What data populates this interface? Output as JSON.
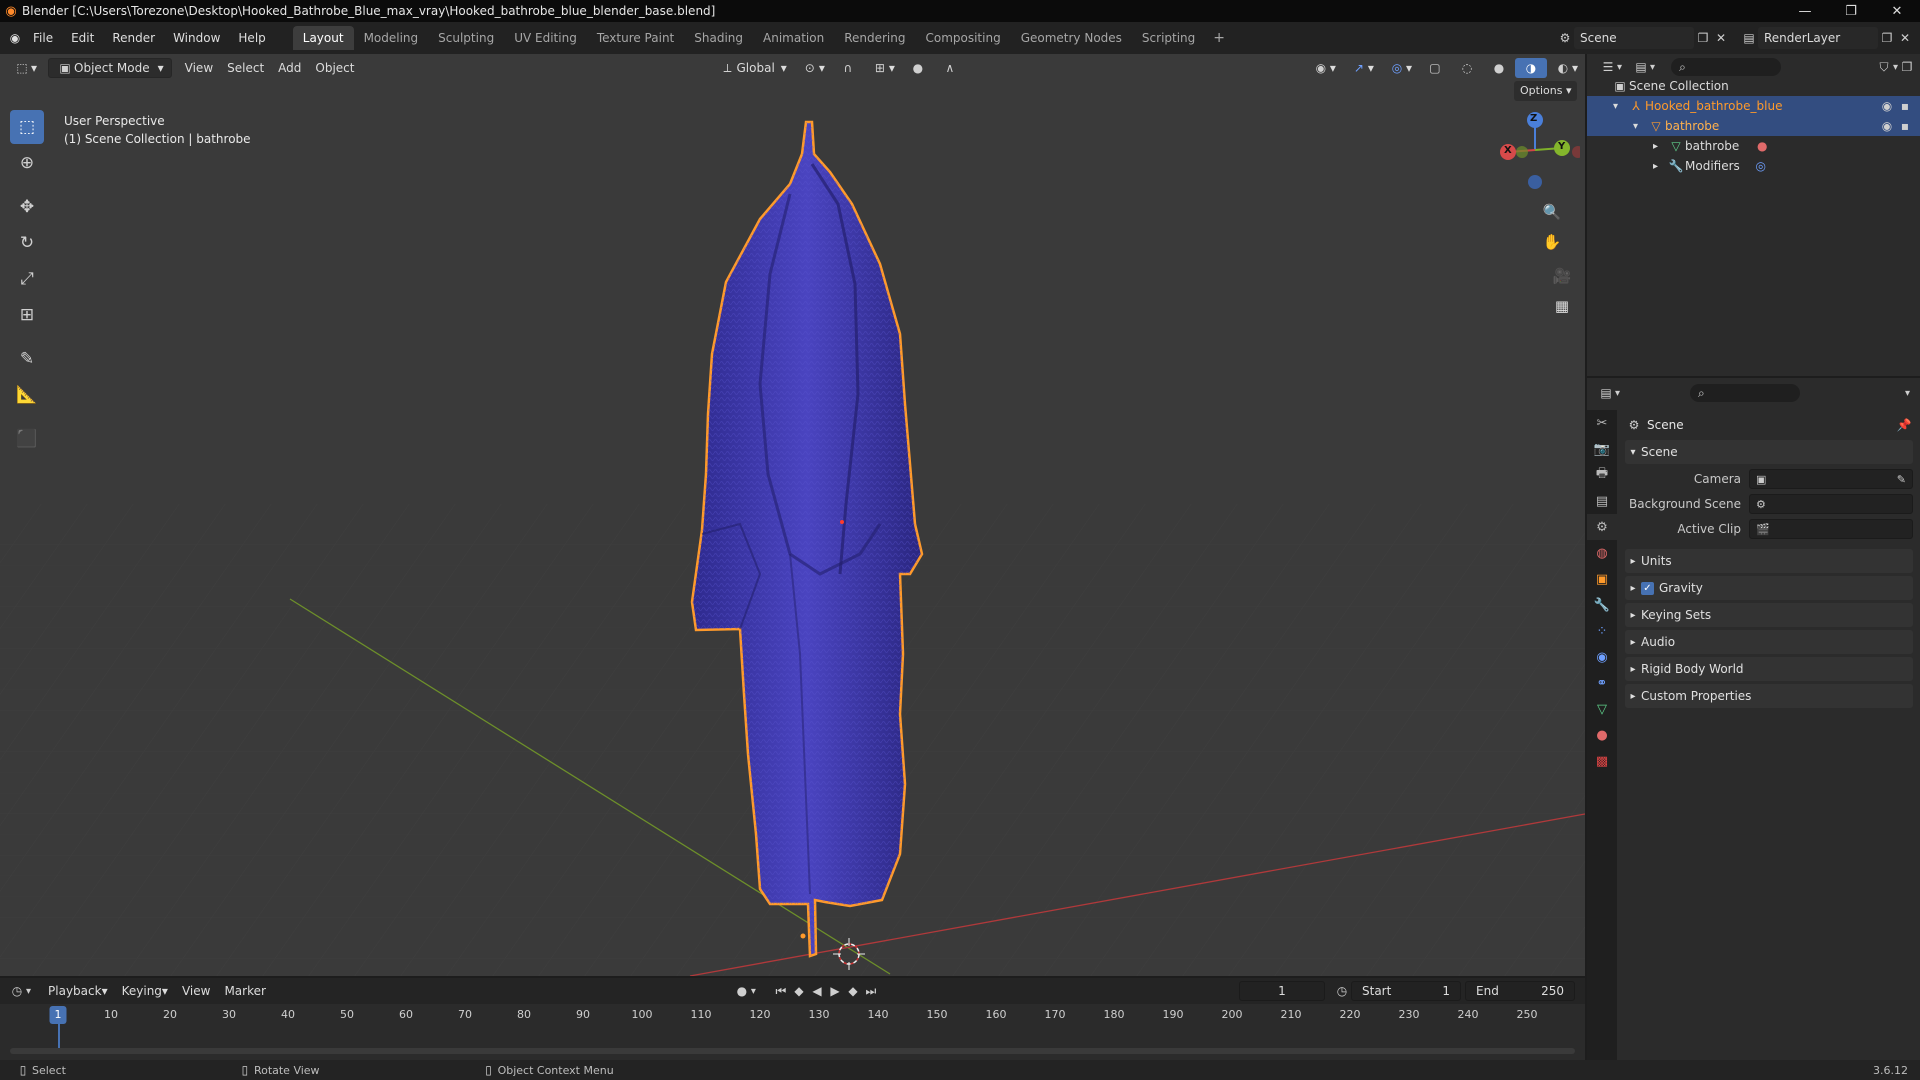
{
  "window": {
    "title": "Blender [C:\\Users\\Torezone\\Desktop\\Hooked_Bathrobe_Blue_max_vray\\Hooked_bathrobe_blue_blender_base.blend]"
  },
  "menu": [
    "File",
    "Edit",
    "Render",
    "Window",
    "Help"
  ],
  "workspaces": [
    {
      "label": "Layout",
      "active": true
    },
    {
      "label": "Modeling"
    },
    {
      "label": "Sculpting"
    },
    {
      "label": "UV Editing"
    },
    {
      "label": "Texture Paint"
    },
    {
      "label": "Shading"
    },
    {
      "label": "Animation"
    },
    {
      "label": "Rendering"
    },
    {
      "label": "Compositing"
    },
    {
      "label": "Geometry Nodes"
    },
    {
      "label": "Scripting"
    }
  ],
  "scene_selector": {
    "scene": "Scene",
    "view_layer": "RenderLayer"
  },
  "viewport": {
    "mode": "Object Mode",
    "header_menus": [
      "View",
      "Select",
      "Add",
      "Object"
    ],
    "transform_orientation": "Global",
    "options_label": "Options",
    "info_line1": "User Perspective",
    "info_line2": "(1) Scene Collection | bathrobe",
    "gizmo_axes": {
      "x": "X",
      "y": "Y",
      "z": "Z"
    },
    "colors": {
      "object": "#3b36a8",
      "selection_outline": "#ff9a2b",
      "axis_x": "#b83a3a",
      "axis_y": "#6b9a2a"
    }
  },
  "outliner": {
    "root": "Scene Collection",
    "items": [
      {
        "label": "Hooked_bathrobe_blue",
        "level": 1,
        "icon": "empty-icon"
      },
      {
        "label": "bathrobe",
        "level": 2,
        "icon": "mesh-object-icon"
      },
      {
        "label": "bathrobe",
        "level": 3,
        "icon": "mesh-data-icon"
      },
      {
        "label": "Modifiers",
        "level": 3,
        "icon": "wrench-icon"
      }
    ]
  },
  "properties": {
    "context": "Scene",
    "section": "Scene",
    "fields": [
      {
        "label": "Camera"
      },
      {
        "label": "Background Scene"
      },
      {
        "label": "Active Clip"
      }
    ],
    "panels": [
      "Units",
      "Gravity",
      "Keying Sets",
      "Audio",
      "Rigid Body World",
      "Custom Properties"
    ],
    "gravity_checked": true
  },
  "timeline": {
    "menus": [
      "Playback",
      "Keying",
      "View",
      "Marker"
    ],
    "current_frame": "1",
    "start_label": "Start",
    "start": "1",
    "end_label": "End",
    "end": "250",
    "ticks": [
      "10",
      "20",
      "30",
      "40",
      "50",
      "60",
      "70",
      "80",
      "90",
      "100",
      "110",
      "120",
      "130",
      "140",
      "150",
      "160",
      "170",
      "180",
      "190",
      "200",
      "210",
      "220",
      "230",
      "240",
      "250"
    ]
  },
  "statusbar": {
    "select": "Select",
    "rotate": "Rotate View",
    "context_menu": "Object Context Menu",
    "version": "3.6.12"
  }
}
